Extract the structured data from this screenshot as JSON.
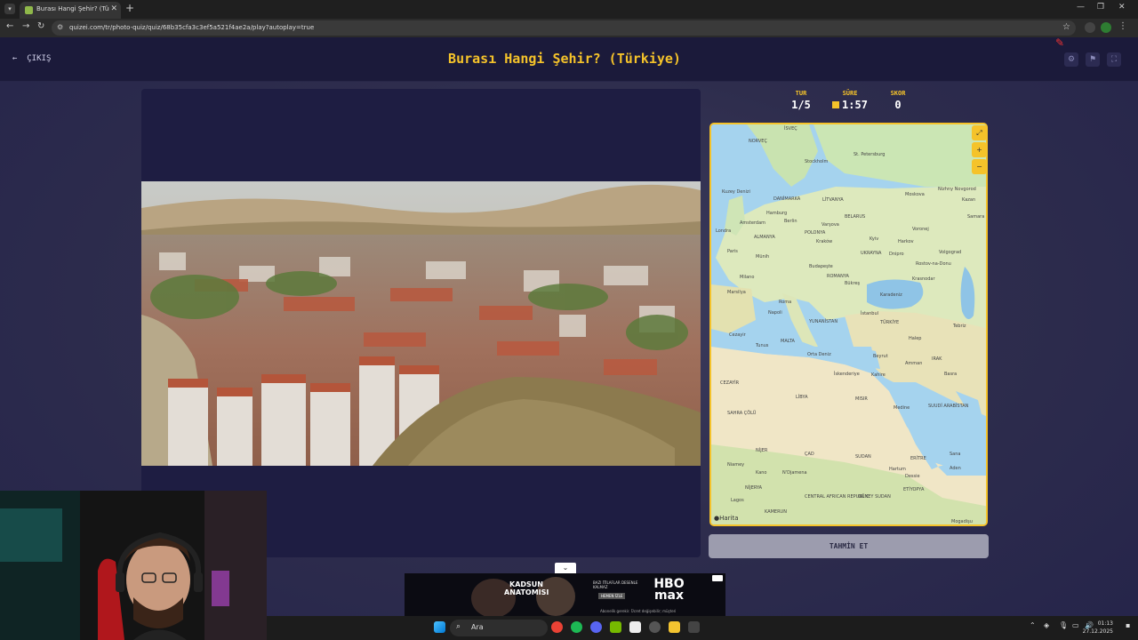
{
  "browser": {
    "tab_title": "Burası Hangi Şehir? (Türkiye) -",
    "url": "quizei.com/tr/photo-quiz/quiz/68b35cfa3c3ef5a521f4ae2a/play?autoplay=true"
  },
  "header": {
    "exit_label": "ÇIKIŞ",
    "title": "Burası Hangi Şehir? (Türkiye)"
  },
  "stats": {
    "round_label": "TUR",
    "round_value": "1/5",
    "time_label": "SÜRE",
    "time_value": "1:57",
    "score_label": "SKOR",
    "score_value": "0"
  },
  "map": {
    "credit": "Harita",
    "labels": {
      "norvec": "NORVEÇ",
      "isvec": "İSVEÇ",
      "stockholm": "Stockholm",
      "stpetersburg": "St. Petersburg",
      "kuzeydenizi": "Kuzey Denizi",
      "danimarka": "DANİMARKA",
      "litvanya": "LİTVANYA",
      "moskova": "Moskova",
      "nizhny": "Nizhny Novgorod",
      "kazan": "Kazan",
      "amsterdam": "Amsterdam",
      "hamburg": "Hamburg",
      "berlin": "Berlin",
      "varsova": "Varşova",
      "belarus": "BELARUS",
      "samara": "Samara",
      "londra": "Londra",
      "almanya": "ALMANYA",
      "polonya": "POLONYA",
      "kyiv": "Kyiv",
      "voronej": "Voronej",
      "paris": "Paris",
      "krakow": "Kraków",
      "harkov": "Harkov",
      "volgograd": "Volgograd",
      "munih": "Münih",
      "ukrayna": "UKRAYNA",
      "budapeste": "Budapeşte",
      "dnipro": "Dnipro",
      "rostov": "Rostov-na-Donu",
      "milano": "Milano",
      "romanya": "ROMANYA",
      "bukres": "Bükreş",
      "krasnodar": "Krasnodar",
      "marsilya": "Marsilya",
      "karadeniz": "Karadeniz",
      "roma": "Roma",
      "napoli": "Napoli",
      "istanbul": "İstanbul",
      "yunanistan": "YUNANİSTAN",
      "turkiye": "TÜRKİYE",
      "tebriz": "Tebriz",
      "cezayir": "Cezayir",
      "tunus": "Tunus",
      "malta": "MALTA",
      "halep": "Halep",
      "irak": "IRAK",
      "beyrut": "Beyrut",
      "amman": "Amman",
      "kahire": "Kahire",
      "basra": "Basra",
      "iskenderiye": "İskenderiye",
      "ortadeniz": "Orta Deniz",
      "cezayir_ulke": "CEZAYİR",
      "libya": "LİBYA",
      "misir": "MISIR",
      "sahra": "SAHRA ÇÖLÜ",
      "medine": "Medine",
      "suudi": "SUUDİ ARABİSTAN",
      "sudan": "SUDAN",
      "eritre": "ERİTRE",
      "nijer": "NİJER",
      "cad": "ÇAD",
      "niamey": "Niamey",
      "kano": "Kano",
      "ncamena": "N'Djamena",
      "hartum": "Hartum",
      "sana": "Sana",
      "aden": "Aden",
      "nijerya": "NİJERYA",
      "lagos": "Lagos",
      "orta_afrika": "CENTRAL AFRICAN REPUBLIC",
      "dunya_sudan": "GÜNEY SUDAN",
      "etiyopya": "ETİYOPYA",
      "kamerun": "KAMERUN",
      "dessie": "Dessie",
      "mogadisu": "Mogadişu"
    }
  },
  "guess_button": "TAHMİN ET",
  "ad": {
    "title": "KADSUN ANATOMISI",
    "brand": "HBO max",
    "tagline": "BAZI İTİLAFLAR DESENLE KALMAZ",
    "sub": "HEMEN İZLE",
    "legal": "Abonelik gerekir. Ücret değişebilir; müşteri"
  },
  "taskbar": {
    "search": "Ara",
    "time": "01:13",
    "date": "27.12.2025"
  }
}
